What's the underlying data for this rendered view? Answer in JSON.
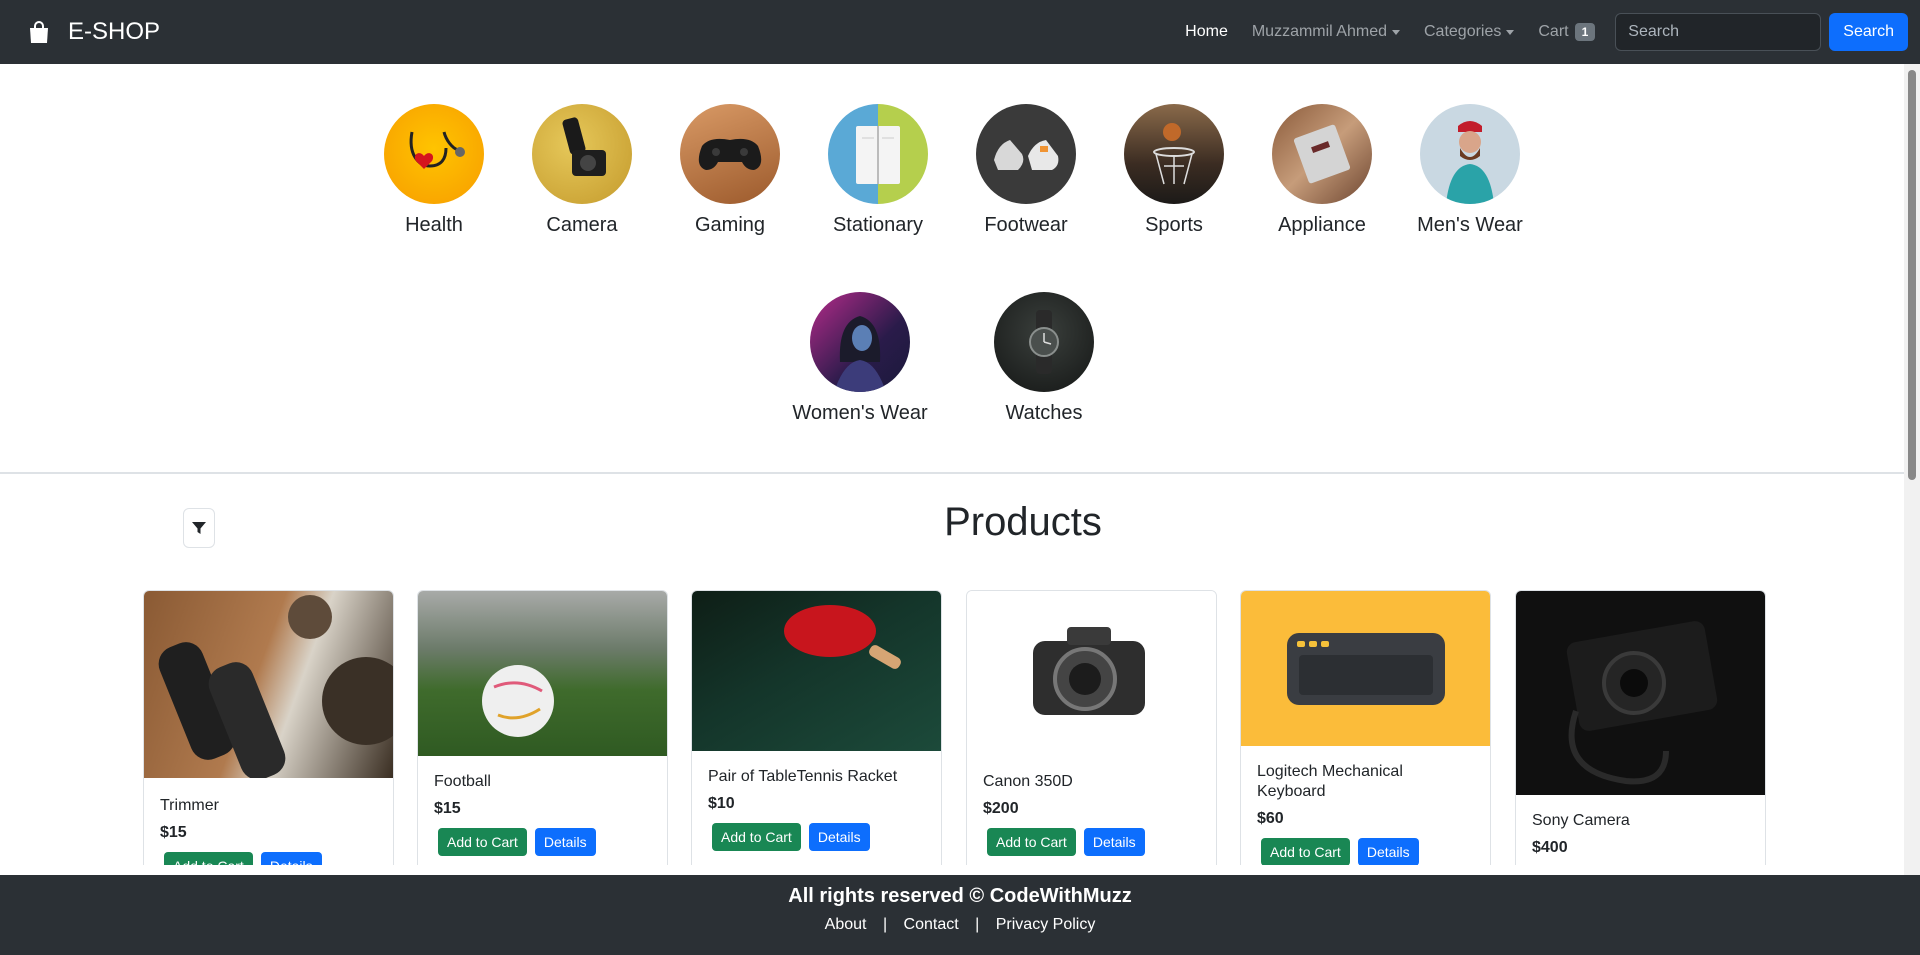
{
  "nav": {
    "brand": "E-SHOP",
    "brand_icon": "shopping-bag-icon",
    "home": "Home",
    "user": "Muzzammil Ahmed",
    "categories": "Categories",
    "cart": "Cart",
    "cart_count": "1",
    "search_placeholder": "Search",
    "search_button": "Search"
  },
  "categories": [
    {
      "name": "Health",
      "icon": "stethoscope-icon"
    },
    {
      "name": "Camera",
      "icon": "camera-icon"
    },
    {
      "name": "Gaming",
      "icon": "gamepad-icon"
    },
    {
      "name": "Stationary",
      "icon": "notebook-icon"
    },
    {
      "name": "Footwear",
      "icon": "sneaker-icon"
    },
    {
      "name": "Sports",
      "icon": "basketball-icon"
    },
    {
      "name": "Appliance",
      "icon": "appliance-icon"
    },
    {
      "name": "Men's Wear",
      "icon": "mens-wear-icon"
    },
    {
      "name": "Women's Wear",
      "icon": "womens-wear-icon"
    },
    {
      "name": "Watches",
      "icon": "watch-icon"
    }
  ],
  "products": {
    "title": "Products",
    "filter_icon": "filter-icon",
    "add_label": "Add to Cart",
    "details_label": "Details",
    "items": [
      {
        "title": "Trimmer",
        "price": "$15"
      },
      {
        "title": "Football",
        "price": "$15"
      },
      {
        "title": "Pair of TableTennis Racket",
        "price": "$10"
      },
      {
        "title": "Canon 350D",
        "price": "$200"
      },
      {
        "title": "Logitech Mechanical Keyboard",
        "price": "$60"
      },
      {
        "title": "Sony Camera",
        "price": "$400"
      }
    ]
  },
  "footer": {
    "copyright": "All rights reserved © CodeWithMuzz",
    "about": "About",
    "contact": "Contact",
    "privacy": "Privacy Policy",
    "separator": "|"
  },
  "colors": {
    "navbar": "#2b3035",
    "primary": "#0d6efd",
    "success": "#198754"
  }
}
